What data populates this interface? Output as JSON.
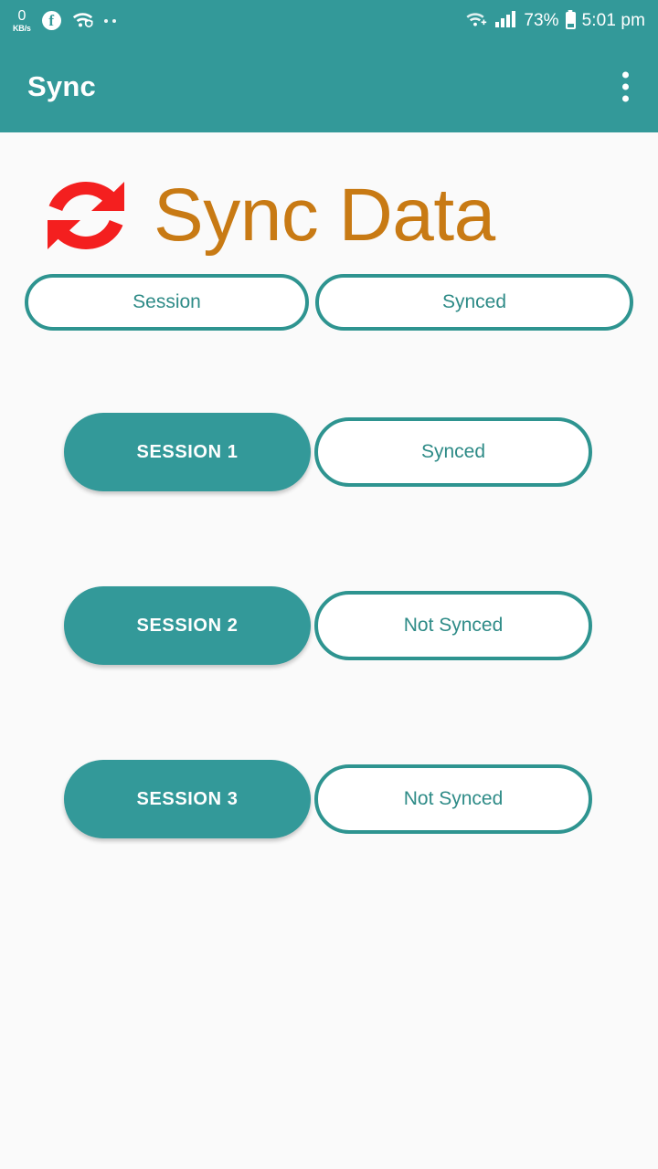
{
  "theme": {
    "primary": "#339999",
    "primary_border": "#2E9490",
    "text_teal": "#2E8B87",
    "logo_orange": "#C87A14",
    "sync_icon_red": "#F41F1F",
    "background": "#FAFAFA",
    "on_primary": "#FFFFFF"
  },
  "status_bar": {
    "network_speed_value": "0",
    "network_speed_unit": "KB/s",
    "facebook_icon": "facebook-icon",
    "wifi_icon": "wifi-secure-icon",
    "more_icons": "more-status-dots-icon",
    "wifi_calling_icon": "wifi-calling-icon",
    "signal_icon": "cellular-signal-icon",
    "battery_percent": "73%",
    "battery_icon": "battery-icon",
    "time": "5:01 pm"
  },
  "app_bar": {
    "title": "Sync",
    "overflow_menu_icon": "overflow-menu-icon"
  },
  "logo": {
    "icon": "sync-arrows-icon",
    "text": "Sync Data"
  },
  "table": {
    "headers": {
      "session_label": "Session",
      "status_label": "Synced"
    },
    "rows": [
      {
        "session": "SESSION 1",
        "status": "Synced"
      },
      {
        "session": "SESSION 2",
        "status": "Not Synced"
      },
      {
        "session": "SESSION 3",
        "status": "Not Synced"
      }
    ]
  }
}
